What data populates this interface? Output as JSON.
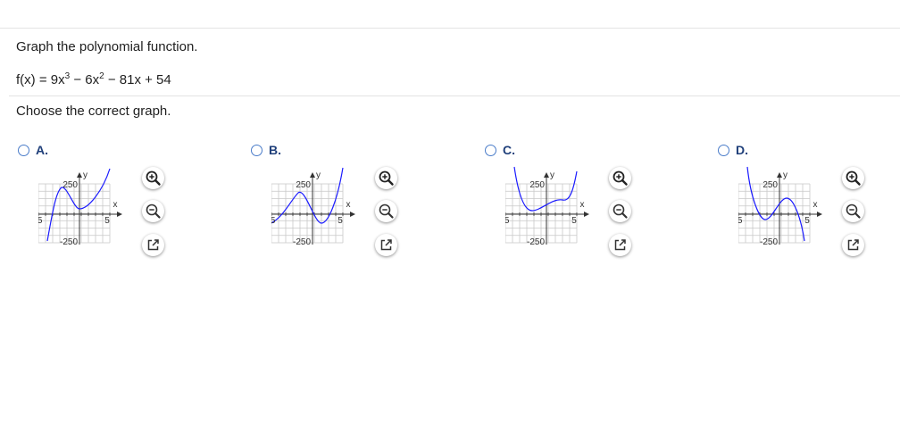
{
  "question": {
    "prompt": "Graph the polynomial function.",
    "function_parts": [
      "f(x) = 9x",
      "3",
      " − 6x",
      "2",
      " − 81x + 54"
    ],
    "instruction": "Choose the correct graph."
  },
  "graph_labels": {
    "y": "y",
    "x": "x",
    "y_top": "250",
    "y_bottom": "-250",
    "x_left": "-5",
    "x_right": "5"
  },
  "options": [
    {
      "letter": "A.",
      "curve": "A"
    },
    {
      "letter": "B.",
      "curve": "B"
    },
    {
      "letter": "C.",
      "curve": "C"
    },
    {
      "letter": "D.",
      "curve": "D"
    }
  ],
  "colors": {
    "curve": "#1a1aff",
    "grid": "#c8c8c8",
    "axis": "#333333",
    "radio": "#4a7cc9"
  },
  "icons": {
    "zoom_in": "zoom-in-icon",
    "zoom_out": "zoom-out-icon",
    "popout": "popout-icon"
  }
}
